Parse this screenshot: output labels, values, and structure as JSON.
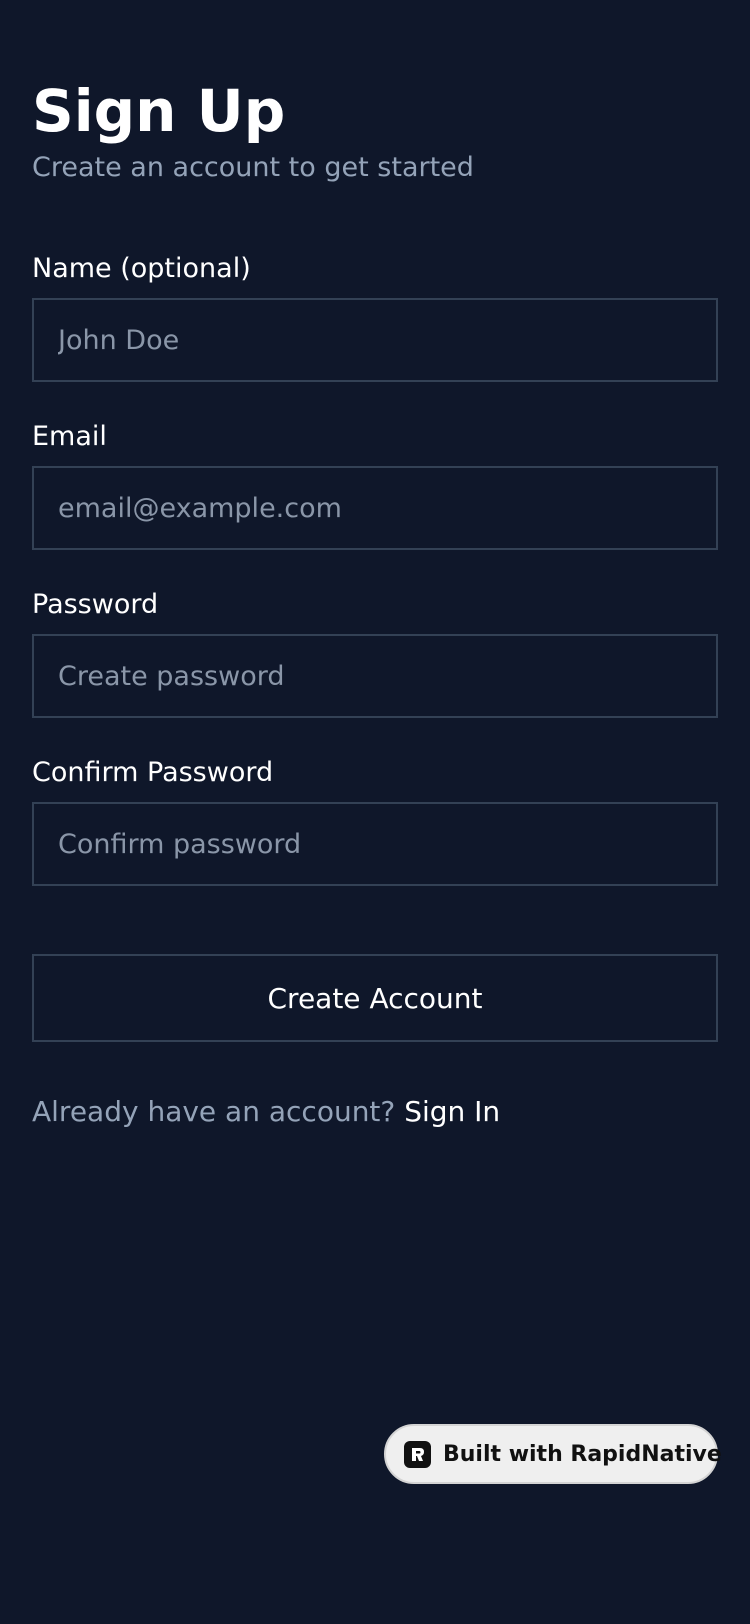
{
  "header": {
    "title": "Sign Up",
    "subtitle": "Create an account to get started"
  },
  "form": {
    "name": {
      "label": "Name (optional)",
      "value": "",
      "placeholder": "John Doe"
    },
    "email": {
      "label": "Email",
      "value": "",
      "placeholder": "email@example.com"
    },
    "password": {
      "label": "Password",
      "value": "",
      "placeholder": "Create password"
    },
    "confirm_password": {
      "label": "Confirm Password",
      "value": "",
      "placeholder": "Confirm password"
    },
    "submit_label": "Create Account"
  },
  "footer": {
    "prompt": "Already have an account?",
    "link": "Sign In"
  },
  "badge": {
    "icon": "rapidnative-logo-icon",
    "label": "Built with RapidNative"
  },
  "colors": {
    "background": "#0f172a",
    "border": "#334155",
    "muted_text": "#94a3b8",
    "text": "#ffffff",
    "badge_background": "#efefef"
  }
}
